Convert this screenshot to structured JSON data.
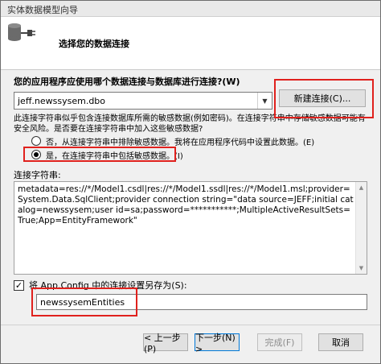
{
  "window": {
    "title": "实体数据模型向导"
  },
  "header": {
    "title": "选择您的数据连接",
    "icon": "database-connection-icon"
  },
  "question": "您的应用程序应使用哪个数据连接与数据库进行连接?(W)",
  "connection_combo": {
    "value": "jeff.newssysem.dbo"
  },
  "new_connection_button": "新建连接(C)...",
  "description": "此连接字符串似乎包含连接数据库所需的敏感数据(例如密码)。在连接字符串中存储敏感数据可能有安全风险。是否要在连接字符串中加入这些敏感数据?",
  "radio_options": [
    {
      "label": "否，从连接字符串中排除敏感数据。我将在应用程序代码中设置此数据。(E)",
      "checked": false
    },
    {
      "label": "是，在连接字符串中包括敏感数据。(I)",
      "checked": true
    }
  ],
  "connection_string_label": "连接字符串:",
  "connection_string": "metadata=res://*/Model1.csdl|res://*/Model1.ssdl|res://*/Model1.msl;provider=System.Data.SqlClient;provider connection string=\"data source=JEFF;initial catalog=newssysem;user id=sa;password=***********;MultipleActiveResultSets=True;App=EntityFramework\"",
  "save_checkbox": {
    "label": "将 App.Config 中的连接设置另存为(S):",
    "checked": true,
    "mark": "✓"
  },
  "entity_name": "newssysemEntities",
  "buttons": {
    "prev": "< 上一步(P)",
    "next": "下一步(N) >",
    "finish": "完成(F)",
    "cancel": "取消"
  },
  "colors": {
    "highlight": "#e0211d",
    "accent": "#0078d7"
  }
}
